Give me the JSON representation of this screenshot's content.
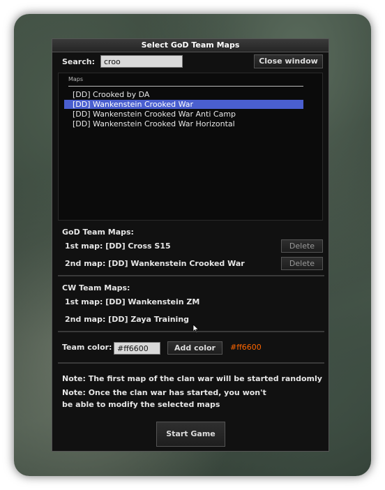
{
  "window": {
    "title": "Select GoD Team Maps"
  },
  "search": {
    "label": "Search:",
    "value": "croo"
  },
  "close_button": "Close window",
  "maps_list": {
    "header": "Maps",
    "items": [
      {
        "label": "[DD] Crooked by DA",
        "selected": false
      },
      {
        "label": "[DD] Wankenstein Crooked War",
        "selected": true
      },
      {
        "label": "[DD] Wankenstein Crooked War Anti Camp",
        "selected": false
      },
      {
        "label": "[DD] Wankenstein Crooked War Horizontal",
        "selected": false
      }
    ]
  },
  "god_team": {
    "heading": "GoD Team Maps:",
    "first": "1st map: [DD] Cross S15",
    "second": "2nd map: [DD] Wankenstein Crooked War",
    "delete_label": "Delete"
  },
  "cw_team": {
    "heading": "CW Team Maps:",
    "first": "1st map: [DD] Wankenstein ZM",
    "second": "2nd map: [DD] Zaya Training"
  },
  "team_color": {
    "label": "Team color:",
    "value": "#ff6600",
    "add_button": "Add color",
    "display": "#ff6600",
    "display_color": "#ff6600"
  },
  "notes": {
    "line1": "Note: The first map of the clan war will be started randomly",
    "line2a": "Note: Once the clan war has started, you won't",
    "line2b": "be able to modify the selected maps"
  },
  "start_button": "Start Game",
  "colors": {
    "selection": "#4a5fcf",
    "window_bg": "#111111"
  }
}
